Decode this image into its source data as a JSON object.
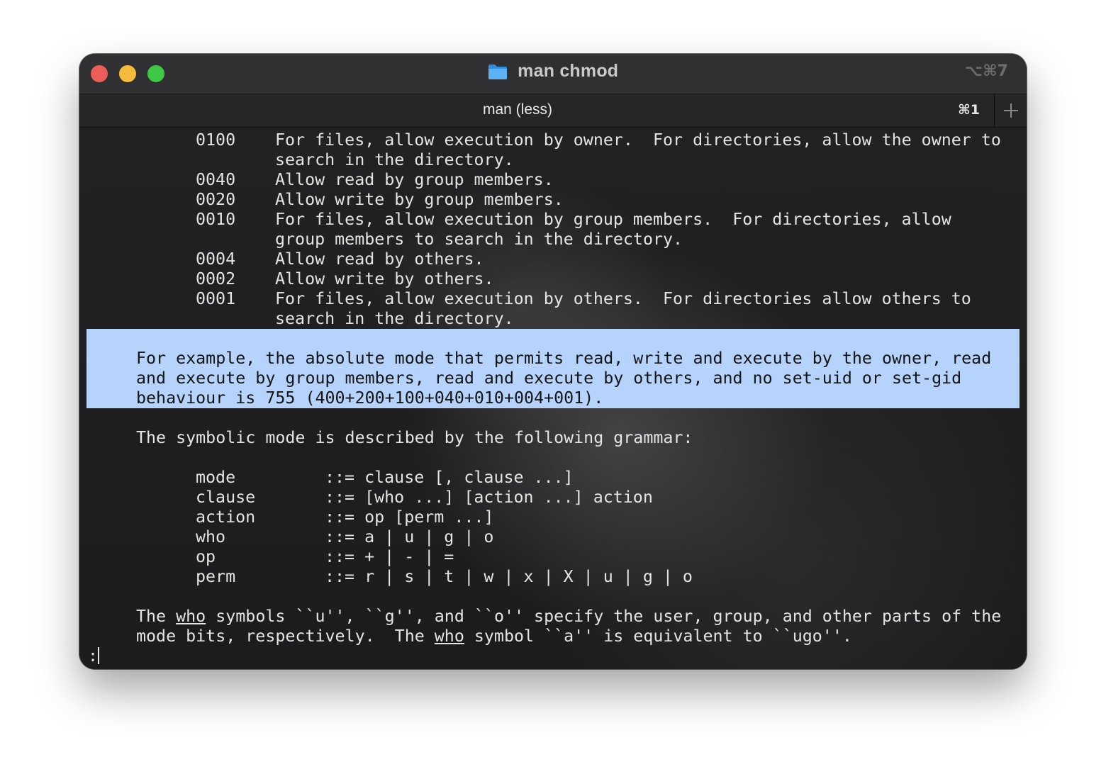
{
  "window": {
    "title": "man chmod",
    "window_shortcut": "⌥⌘7"
  },
  "tab": {
    "label": "man (less)",
    "shortcut": "⌘1"
  },
  "icons": [
    "folder-icon",
    "plus-icon"
  ],
  "colors": {
    "selection_highlight": "#b6d3fc",
    "close": "#ec5f58",
    "minimize": "#f4bb3c",
    "zoom": "#3ec744"
  },
  "perm_table": [
    {
      "code": "0100",
      "lines": [
        "For files, allow execution by owner.  For directories, allow the owner to",
        "search in the directory."
      ]
    },
    {
      "code": "0040",
      "lines": [
        "Allow read by group members."
      ]
    },
    {
      "code": "0020",
      "lines": [
        "Allow write by group members."
      ]
    },
    {
      "code": "0010",
      "lines": [
        "For files, allow execution by group members.  For directories, allow",
        "group members to search in the directory."
      ]
    },
    {
      "code": "0004",
      "lines": [
        "Allow read by others."
      ]
    },
    {
      "code": "0002",
      "lines": [
        "Allow write by others."
      ]
    },
    {
      "code": "0001",
      "lines": [
        "For files, allow execution by others.  For directories allow others to",
        "search in the directory."
      ]
    }
  ],
  "example_paragraph": [
    "For example, the absolute mode that permits read, write and execute by the owner, read",
    "and execute by group members, read and execute by others, and no set-uid or set-gid",
    "behaviour is 755 (400+200+100+040+010+004+001)."
  ],
  "grammar_intro": "The symbolic mode is described by the following grammar:",
  "grammar": [
    {
      "term": "mode",
      "rule": "::= clause [, clause ...]"
    },
    {
      "term": "clause",
      "rule": "::= [who ...] [action ...] action"
    },
    {
      "term": "action",
      "rule": "::= op [perm ...]"
    },
    {
      "term": "who",
      "rule": "::= a | u | g | o"
    },
    {
      "term": "op",
      "rule": "::= + | - | ="
    },
    {
      "term": "perm",
      "rule": "::= r | s | t | w | x | X | u | g | o"
    }
  ],
  "who_paragraph": {
    "l1_a": "The ",
    "l1_who": "who",
    "l1_b": " symbols ``u'', ``g'', and ``o'' specify the user, group, and other parts of the",
    "l2_a": "mode bits, respectively.  The ",
    "l2_who": "who",
    "l2_b": " symbol ``a'' is equivalent to ``ugo''."
  },
  "prompt": ":"
}
